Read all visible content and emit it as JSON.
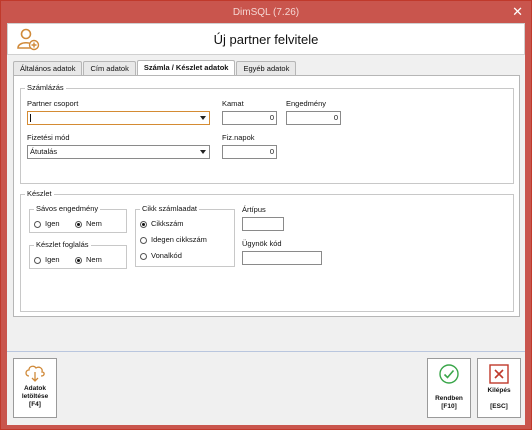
{
  "window": {
    "title": "DimSQL (7.26)",
    "close_glyph": "✕"
  },
  "header": {
    "title": "Új partner felvitele",
    "icon": "user-add-icon"
  },
  "tabs": [
    {
      "label": "Általános adatok",
      "active": false
    },
    {
      "label": "Cím adatok",
      "active": false
    },
    {
      "label": "Számla / Készlet adatok",
      "active": true
    },
    {
      "label": "Egyéb adatok",
      "active": false
    }
  ],
  "billing": {
    "legend": "Számlázás",
    "partner_group_label": "Partner csoport",
    "partner_group_value": "",
    "interest_label": "Kamat",
    "interest_value": "0",
    "discount_label": "Engedmény",
    "discount_value": "0",
    "payment_method_label": "Fizetési mód",
    "payment_method_value": "Átutalás",
    "payment_days_label": "Fiz.napok",
    "payment_days_value": "0"
  },
  "stock": {
    "legend": "Készlet",
    "band_discount": {
      "legend": "Sávos engedmény",
      "yes": "Igen",
      "no": "Nem",
      "selected": "no"
    },
    "stock_booking": {
      "legend": "Készlet foglalás",
      "yes": "Igen",
      "no": "Nem",
      "selected": "no"
    },
    "item_billing": {
      "legend": "Cikk számlaadat",
      "options": [
        "Cikkszám",
        "Idegen cikkszám",
        "Vonalkód"
      ],
      "selected": 0
    },
    "price_type_label": "Ártípus",
    "price_type_value": "",
    "agent_code_label": "Ügynök kód",
    "agent_code_value": ""
  },
  "buttons": {
    "download": {
      "line1": "Adatok",
      "line2": "letöltése",
      "key": "[F4]",
      "icon": "cloud-download-icon"
    },
    "ok": {
      "line1": "Rendben",
      "key": "[F10]",
      "icon": "check-circle-icon"
    },
    "exit": {
      "line1": "Kilépés",
      "key": "[ESC]",
      "icon": "close-box-icon"
    }
  },
  "colors": {
    "title_bar": "#c9554d",
    "header_icon": "#d08a3a",
    "ok_icon": "#3aa64a",
    "exit_icon": "#c0392b",
    "download_icon": "#d08a3a"
  }
}
